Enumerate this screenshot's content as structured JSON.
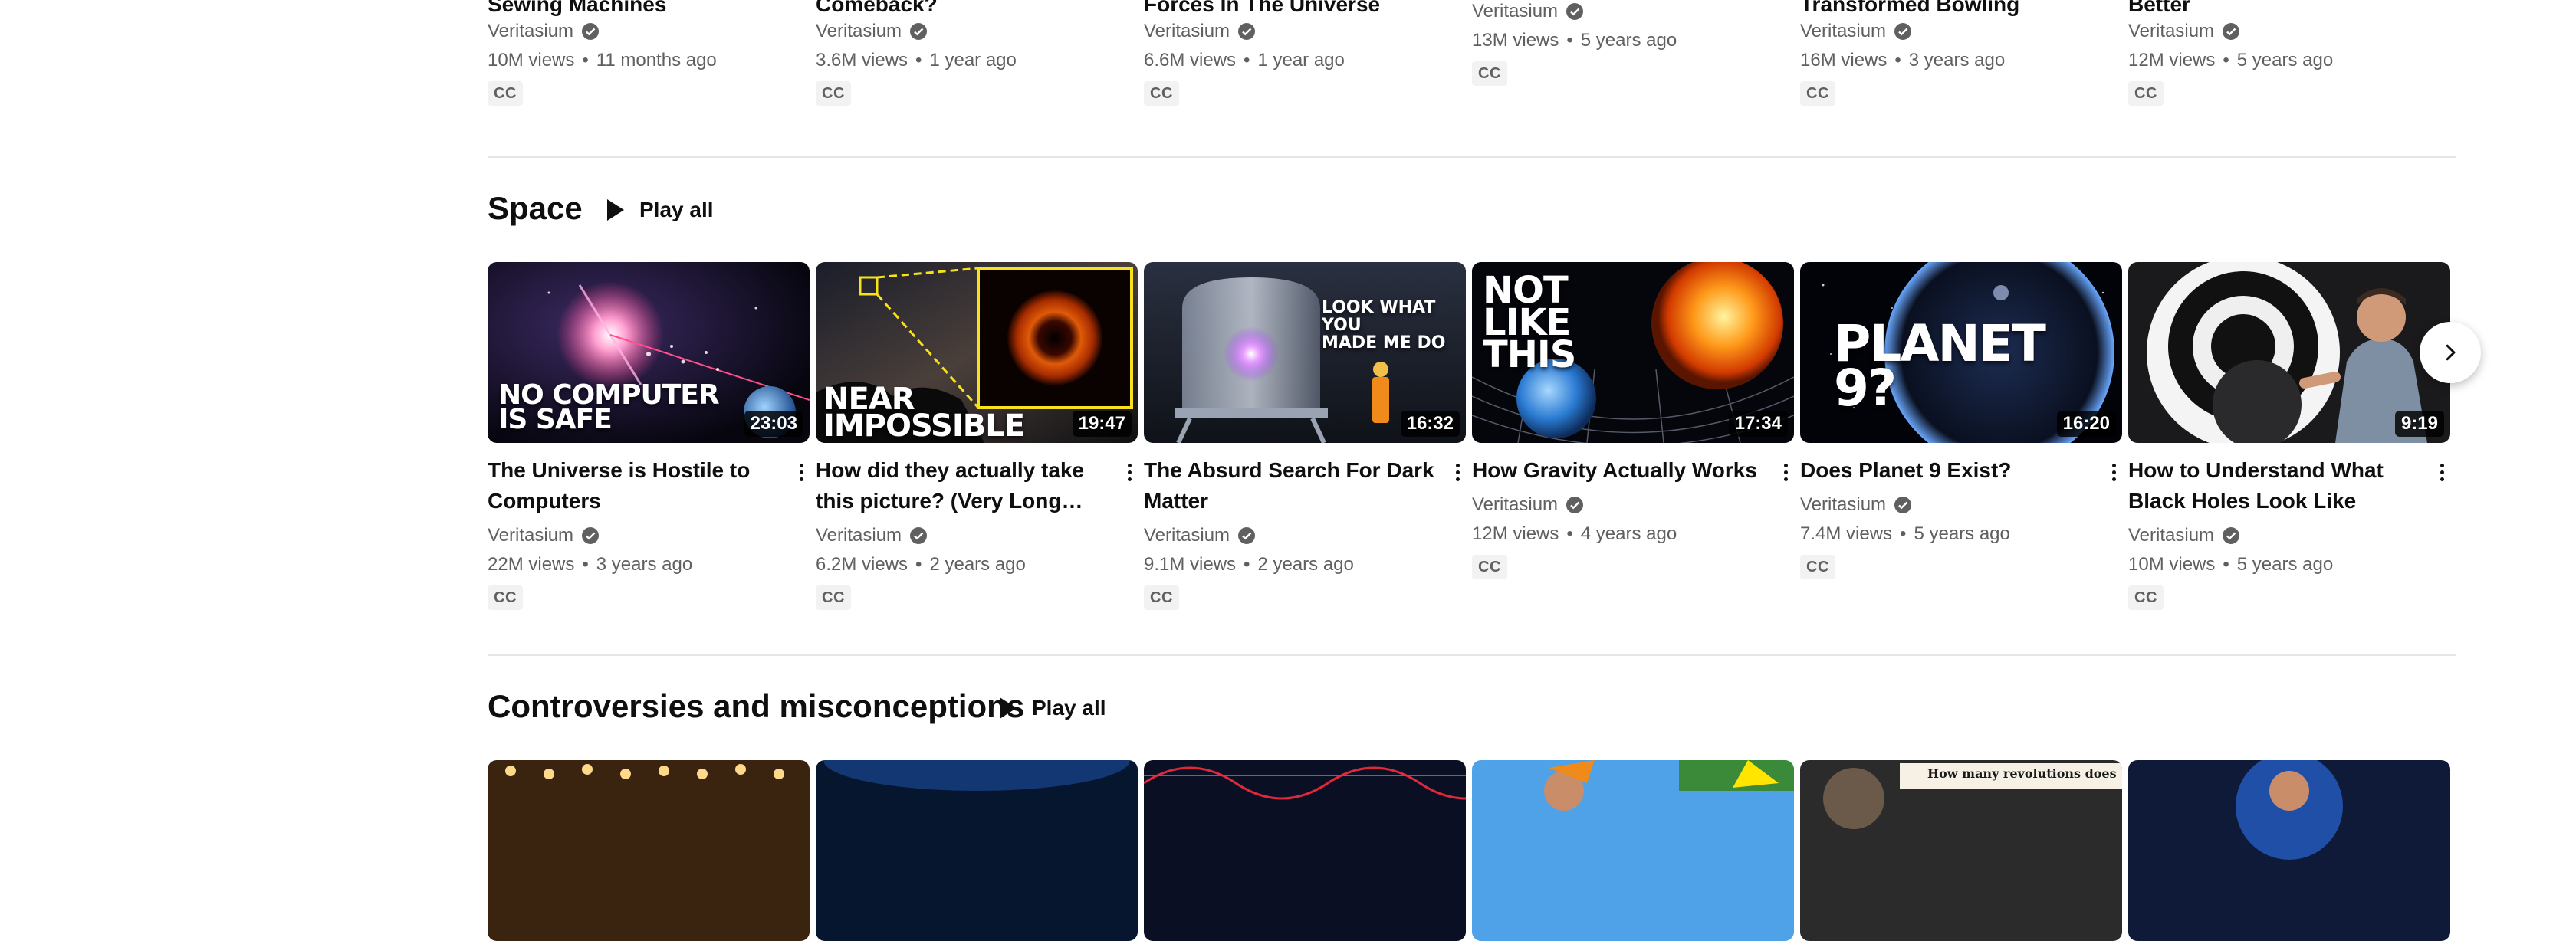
{
  "top_row": [
    {
      "title": "Sewing Machines",
      "channel": "Veritasium",
      "views": "10M views",
      "age": "11 months ago",
      "cc": "CC"
    },
    {
      "title": "Comeback?",
      "channel": "Veritasium",
      "views": "3.6M views",
      "age": "1 year ago",
      "cc": "CC"
    },
    {
      "title": "Forces In The Universe",
      "channel": "Veritasium",
      "views": "6.6M views",
      "age": "1 year ago",
      "cc": "CC"
    },
    {
      "title": "",
      "channel": "Veritasium",
      "views": "13M views",
      "age": "5 years ago",
      "cc": "CC"
    },
    {
      "title": "Transformed Bowling",
      "channel": "Veritasium",
      "views": "16M views",
      "age": "3 years ago",
      "cc": "CC"
    },
    {
      "title": "Better",
      "channel": "Veritasium",
      "views": "12M views",
      "age": "5 years ago",
      "cc": "CC"
    }
  ],
  "space_shelf": {
    "title": "Space",
    "play_all": "Play all",
    "videos": [
      {
        "title": "The Universe is Hostile to Computers",
        "channel": "Veritasium",
        "views": "22M views",
        "age": "3 years ago",
        "duration": "23:03",
        "cc": "CC",
        "thumb_text": "NO COMPUTER IS SAFE"
      },
      {
        "title": "How did they actually take this picture? (Very Long Baseline Interferometry)",
        "channel": "Veritasium",
        "views": "6.2M views",
        "age": "2 years ago",
        "duration": "19:47",
        "cc": "CC",
        "thumb_text": "NEAR IMPOSSIBLE"
      },
      {
        "title": "The Absurd Search For Dark Matter",
        "channel": "Veritasium",
        "views": "9.1M views",
        "age": "2 years ago",
        "duration": "16:32",
        "cc": "CC",
        "thumb_text": "LOOK WHAT YOU MADE ME DO"
      },
      {
        "title": "How Gravity Actually Works",
        "channel": "Veritasium",
        "views": "12M views",
        "age": "4 years ago",
        "duration": "17:34",
        "cc": "CC",
        "thumb_text": "NOT LIKE THIS"
      },
      {
        "title": "Does Planet 9 Exist?",
        "channel": "Veritasium",
        "views": "7.4M views",
        "age": "5 years ago",
        "duration": "16:20",
        "cc": "CC",
        "thumb_text": "PLANET 9?"
      },
      {
        "title": "How to Understand What Black Holes Look Like",
        "channel": "Veritasium",
        "views": "10M views",
        "age": "5 years ago",
        "duration": "9:19",
        "cc": "CC"
      }
    ]
  },
  "controversies_shelf": {
    "title": "Controversies and misconceptions",
    "play_all": "Play all",
    "peek_thumb_text": "How many revolutions does"
  },
  "colors": {
    "text_primary": "#0f0f0f",
    "text_secondary": "#606060",
    "divider": "#e5e5e5",
    "cc_bg": "#f2f2f2"
  }
}
